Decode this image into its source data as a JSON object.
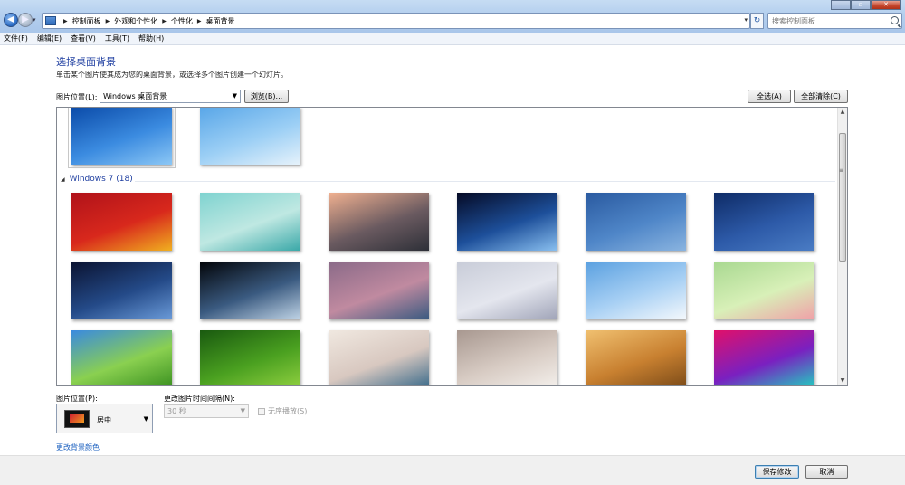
{
  "address": {
    "crumbs": [
      "控制面板",
      "外观和个性化",
      "个性化",
      "桌面背景"
    ]
  },
  "search": {
    "placeholder": "搜索控制面板"
  },
  "menu": [
    "文件(F)",
    "编辑(E)",
    "查看(V)",
    "工具(T)",
    "帮助(H)"
  ],
  "heading": "选择桌面背景",
  "subtitle": "单击某个图片使其成为您的桌面背景，或选择多个图片创建一个幻灯片。",
  "location": {
    "label": "图片位置(L):",
    "value": "Windows 桌面背景",
    "browse": "浏览(B)...",
    "select_all": "全选(A)",
    "clear_all": "全部清除(C)"
  },
  "gallery": {
    "group_label": "Windows 7 (18)",
    "top_thumbs": [
      {
        "name": "windows-logo-wallpaper",
        "colors": [
          "#0a4aa8",
          "#3b8be0",
          "#8cc7f5"
        ]
      },
      {
        "name": "daisy-wallpaper",
        "colors": [
          "#58a6e8",
          "#9ccff5",
          "#e6f2fb"
        ]
      }
    ],
    "thumbs": [
      {
        "name": "new-year-wallpaper",
        "colors": [
          "#b0121a",
          "#d8281c",
          "#f0b020"
        ]
      },
      {
        "name": "2015-wallpaper",
        "colors": [
          "#7fd3d0",
          "#bfe8e2",
          "#3aa8a8"
        ]
      },
      {
        "name": "mountain-dawn-wallpaper",
        "colors": [
          "#f0b090",
          "#6a5a60",
          "#2e3038"
        ]
      },
      {
        "name": "earth-moon-wallpaper",
        "colors": [
          "#050a25",
          "#1d4f9a",
          "#8ac0f0"
        ]
      },
      {
        "name": "blue-sky-sea-wallpaper",
        "colors": [
          "#2a5aa0",
          "#4f86c8",
          "#8ab4e0"
        ]
      },
      {
        "name": "milky-way-wallpaper",
        "colors": [
          "#0e2b66",
          "#2d5aa8",
          "#4a7cc4"
        ]
      },
      {
        "name": "galaxy-wallpaper",
        "colors": [
          "#0a1230",
          "#244a88",
          "#6a9ad8"
        ]
      },
      {
        "name": "earth-orbit-wallpaper",
        "colors": [
          "#020408",
          "#3a5a80",
          "#c0d4e6"
        ]
      },
      {
        "name": "lake-dusk-wallpaper",
        "colors": [
          "#8a6a88",
          "#c08aa0",
          "#3a5a80"
        ]
      },
      {
        "name": "red-berries-wallpaper",
        "colors": [
          "#c8ccd8",
          "#e4e6ee",
          "#a0a4b8"
        ]
      },
      {
        "name": "frost-trees-wallpaper",
        "colors": [
          "#5aa0e0",
          "#a8d0f4",
          "#f4f8fc"
        ]
      },
      {
        "name": "pink-flower-wallpaper",
        "colors": [
          "#a8d890",
          "#d8f0b8",
          "#f0a0a8"
        ]
      },
      {
        "name": "green-field-wallpaper",
        "colors": [
          "#3a8ae0",
          "#8ad050",
          "#3a9020"
        ]
      },
      {
        "name": "lotus-leaf-wallpaper",
        "colors": [
          "#1a5a10",
          "#4aa020",
          "#90d040"
        ]
      },
      {
        "name": "girl-portrait-wallpaper",
        "colors": [
          "#f0e8e0",
          "#d8c8c0",
          "#3a6a8a"
        ]
      },
      {
        "name": "girl-headphones-wallpaper",
        "colors": [
          "#a89890",
          "#d8ccc4",
          "#f4f0ec"
        ]
      },
      {
        "name": "headphones-wallpaper",
        "colors": [
          "#f0c070",
          "#c88030",
          "#7a4a18"
        ]
      },
      {
        "name": "geometric-neon-wallpaper",
        "colors": [
          "#e0106a",
          "#7a20c0",
          "#20d0c0"
        ]
      }
    ]
  },
  "options": {
    "position_label": "图片位置(P):",
    "position_value": "居中",
    "interval_label": "更改图片时间间隔(N):",
    "interval_value": "30 秒",
    "shuffle_label": "无序播放(S)",
    "change_color_link": "更改背景颜色"
  },
  "footer": {
    "save": "保存修改",
    "cancel": "取消"
  }
}
